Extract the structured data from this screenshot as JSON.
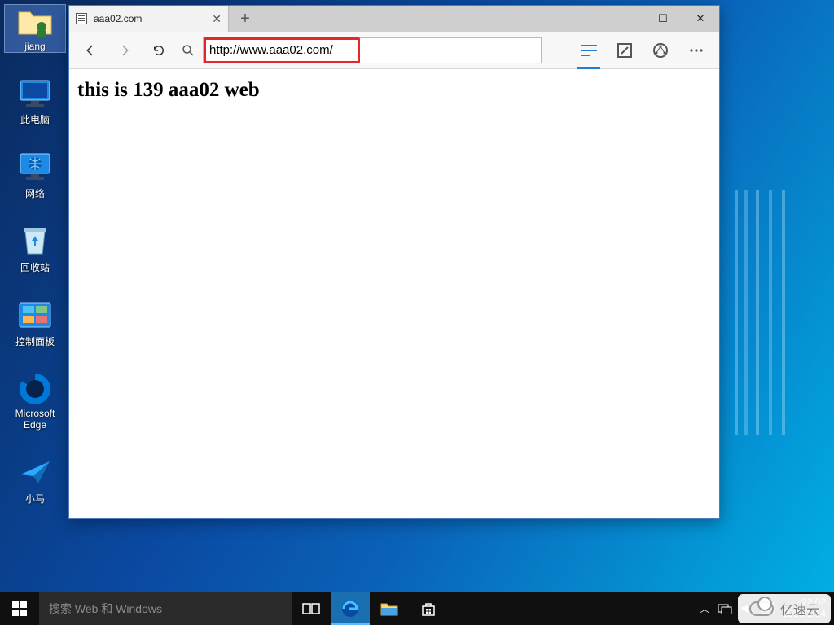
{
  "desktop_icons": {
    "user_folder": "jiang",
    "this_pc": "此电脑",
    "network": "网络",
    "recycle_bin": "回收站",
    "control_panel": "控制面板",
    "edge": "Microsoft Edge",
    "xiaoma": "小马"
  },
  "browser": {
    "tab_title": "aaa02.com",
    "url": "http://www.aaa02.com/",
    "page_heading": "this is 139 aaa02 web"
  },
  "taskbar": {
    "search_placeholder": "搜索 Web 和 Windows",
    "time": "22:02",
    "date": "2020/1/14"
  },
  "watermark": "亿速云"
}
